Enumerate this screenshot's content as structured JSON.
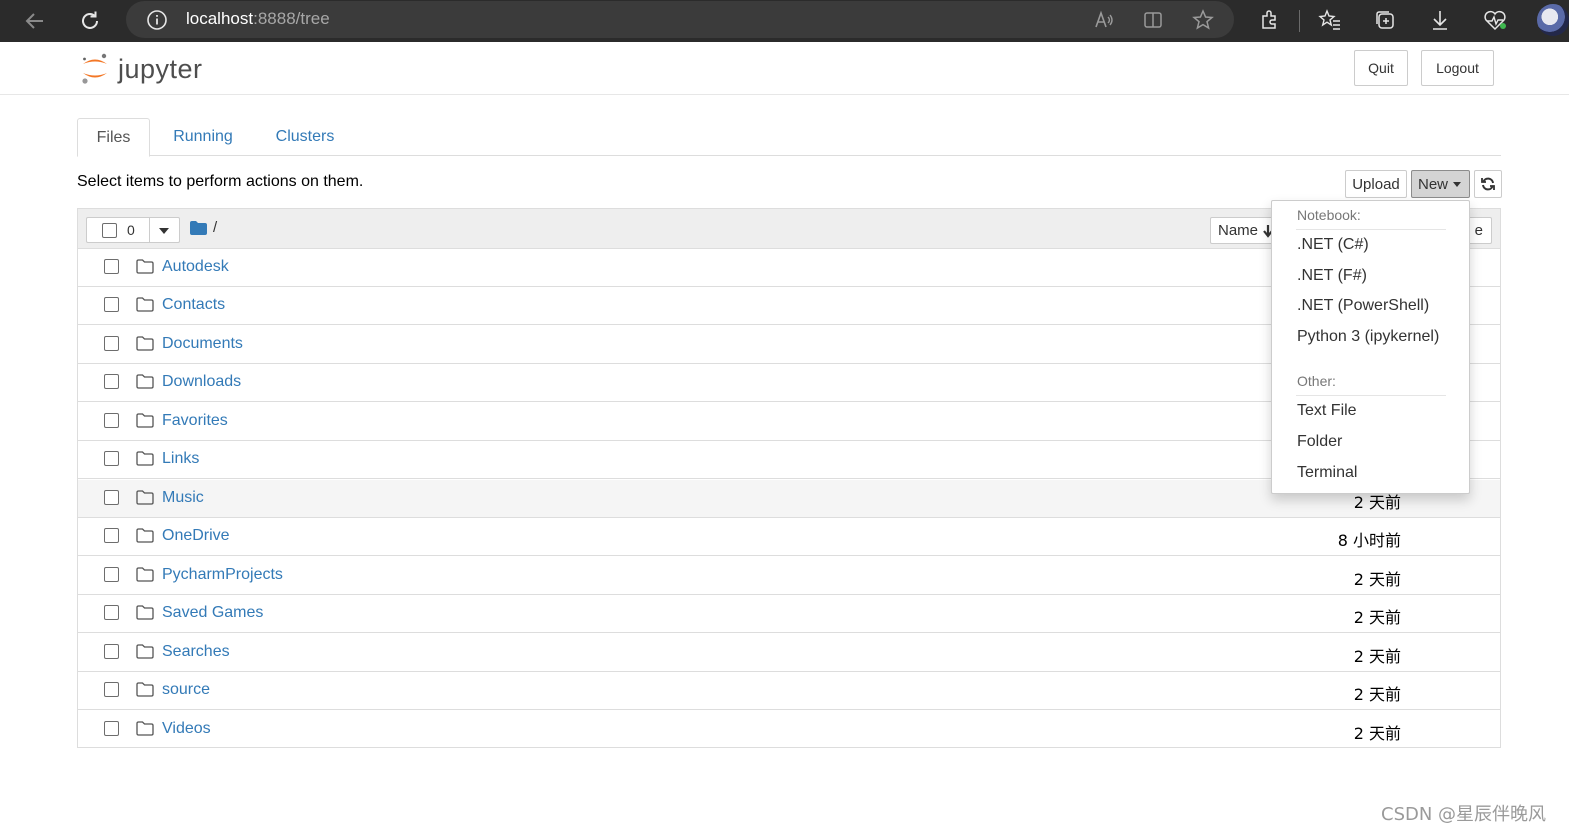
{
  "browser": {
    "url_host": "localhost",
    "url_path": ":8888/tree"
  },
  "header": {
    "logo_text": "jupyter",
    "quit_label": "Quit",
    "logout_label": "Logout"
  },
  "tabs": [
    {
      "label": "Files",
      "active": true
    },
    {
      "label": "Running",
      "active": false
    },
    {
      "label": "Clusters",
      "active": false
    }
  ],
  "toolbar": {
    "hint": "Select items to perform actions on them.",
    "upload_label": "Upload",
    "new_label": "New"
  },
  "list_header": {
    "selected_count": "0",
    "breadcrumb": "/",
    "sort_name_label": "Name",
    "sort_modified_partial": "e"
  },
  "files": [
    {
      "name": "Autodesk",
      "modified": ""
    },
    {
      "name": "Contacts",
      "modified": ""
    },
    {
      "name": "Documents",
      "modified": ""
    },
    {
      "name": "Downloads",
      "modified": ""
    },
    {
      "name": "Favorites",
      "modified": ""
    },
    {
      "name": "Links",
      "modified": ""
    },
    {
      "name": "Music",
      "modified": "2 天前"
    },
    {
      "name": "OneDrive",
      "modified": "8 小时前"
    },
    {
      "name": "PycharmProjects",
      "modified": "2 天前"
    },
    {
      "name": "Saved Games",
      "modified": "2 天前"
    },
    {
      "name": "Searches",
      "modified": "2 天前"
    },
    {
      "name": "source",
      "modified": "2 天前"
    },
    {
      "name": "Videos",
      "modified": "2 天前"
    }
  ],
  "new_menu": {
    "notebook_header": "Notebook:",
    "notebook_items": [
      ".NET (C#)",
      ".NET (F#)",
      ".NET (PowerShell)",
      "Python 3 (ipykernel)"
    ],
    "other_header": "Other:",
    "other_items": [
      "Text File",
      "Folder",
      "Terminal"
    ]
  },
  "watermark": "CSDN @星辰伴晚风",
  "colors": {
    "link": "#337ab7",
    "jupyter_orange": "#f37726",
    "browser_bar": "#2b2b2b"
  }
}
